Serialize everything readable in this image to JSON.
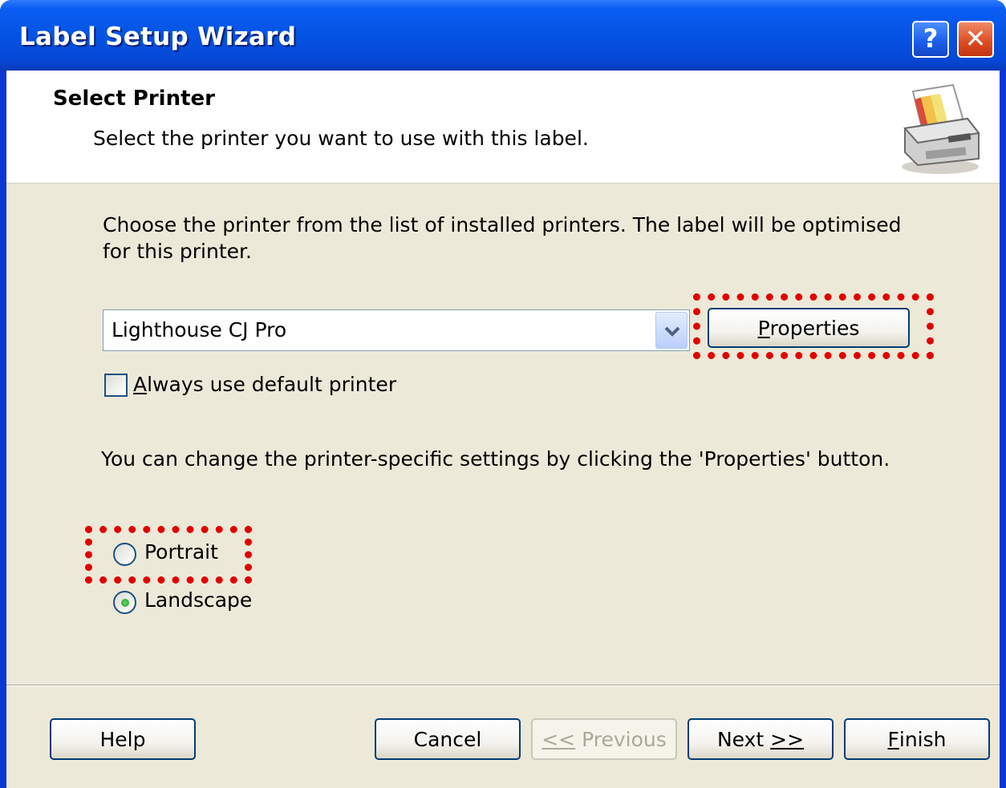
{
  "window": {
    "title": "Label Setup Wizard",
    "help_glyph": "?",
    "close_glyph": "✕"
  },
  "header": {
    "title": "Select Printer",
    "subtitle": "Select the printer you want to use with this label.",
    "icon": "printer-icon"
  },
  "body": {
    "instructions": "Choose the printer from the list of installed printers. The label will be optimised for this printer.",
    "printer_select": {
      "selected": "Lighthouse CJ Pro"
    },
    "properties_button": {
      "mnemonic": "P",
      "rest": "roperties"
    },
    "default_printer_checkbox": {
      "mnemonic": "A",
      "rest": "lways use default printer",
      "checked": false
    },
    "properties_info": "You can change the printer-specific settings by clicking the 'Properties' button.",
    "orientation": {
      "portrait_label": "Portrait",
      "landscape_label": "Landscape",
      "selected": "Landscape"
    }
  },
  "footer": {
    "help": "Help",
    "cancel": "Cancel",
    "previous": {
      "prefix": "<<",
      "text": " Previous",
      "enabled": false
    },
    "next": {
      "text": "Next ",
      "suffix": ">>"
    },
    "finish": {
      "mnemonic": "F",
      "rest": "inish"
    }
  },
  "colors": {
    "highlight_dashes": "#e00000",
    "titlebar": "#0553e4",
    "dialog_bg": "#ece9d8"
  }
}
